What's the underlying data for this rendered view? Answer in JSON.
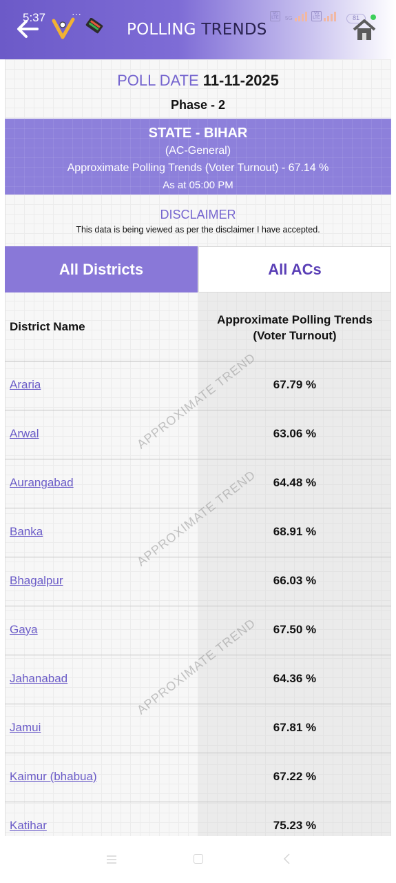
{
  "status_bar": {
    "time": "5:37",
    "more": "···",
    "network_tags": [
      "Vo LTE",
      "5G",
      "Vo LTE"
    ],
    "battery": "81"
  },
  "header": {
    "title_part1": "POLLING ",
    "title_part2": "TRENDS"
  },
  "poll": {
    "date_label": "POLL DATE",
    "date_value": "11-11-2025",
    "phase": "Phase - 2"
  },
  "state": {
    "title": "STATE - BIHAR",
    "ac_type": "(AC-General)",
    "trend": "Approximate Polling Trends (Voter Turnout) - 67.14 %",
    "as_at": "As at 05:00 PM"
  },
  "disclaimer": {
    "title": "DISCLAIMER",
    "text": "This data is being viewed as per the disclaimer I have accepted."
  },
  "tabs": {
    "districts": "All Districts",
    "acs": "All ACs",
    "active": "districts"
  },
  "table": {
    "col_name": "District Name",
    "col_trend_line1": "Approximate Polling Trends",
    "col_trend_line2": "(Voter Turnout)",
    "rows": [
      {
        "name": "Araria",
        "value": "67.79 %"
      },
      {
        "name": "Arwal",
        "value": "63.06 %"
      },
      {
        "name": "Aurangabad",
        "value": "64.48 %"
      },
      {
        "name": "Banka",
        "value": "68.91 %"
      },
      {
        "name": "Bhagalpur",
        "value": "66.03 %"
      },
      {
        "name": "Gaya",
        "value": "67.50 %"
      },
      {
        "name": "Jahanabad",
        "value": "64.36 %"
      },
      {
        "name": "Jamui",
        "value": "67.81 %"
      },
      {
        "name": "Kaimur (bhabua)",
        "value": "67.22 %"
      },
      {
        "name": "Katihar",
        "value": "75.23 %"
      }
    ]
  },
  "watermark": "APPROXIMATE TREND",
  "colors": {
    "primary": "#7565cf",
    "tab_active": "#8978d8",
    "state_box": "#8d80db",
    "link": "#6b5cc8"
  }
}
